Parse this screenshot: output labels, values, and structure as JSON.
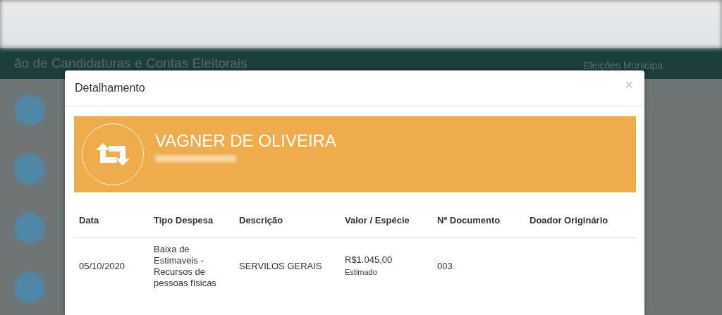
{
  "backdrop": {
    "header_title": "ão de Candidaturas e Contas Eleitorais",
    "header_right": "Eleições Municipa"
  },
  "modal": {
    "title": "Detalhamento",
    "close": "×",
    "banner": {
      "name": "VAGNER DE OLIVEIRA"
    },
    "table": {
      "columns": [
        "Data",
        "Tipo Despesa",
        "Descrição",
        "Valor / Espécie",
        "Nº Documento",
        "Doador Originário"
      ],
      "rows": [
        {
          "cells": [
            {
              "text": "05/10/2020"
            },
            {
              "text": "Baixa de Estimaveis - Recursos de pessoas físicas"
            },
            {
              "text": "SERVILOS GERAIS"
            },
            {
              "text": "R$1.045,00",
              "note": "Estimado"
            },
            {
              "text": "003"
            }
          ]
        }
      ]
    }
  }
}
